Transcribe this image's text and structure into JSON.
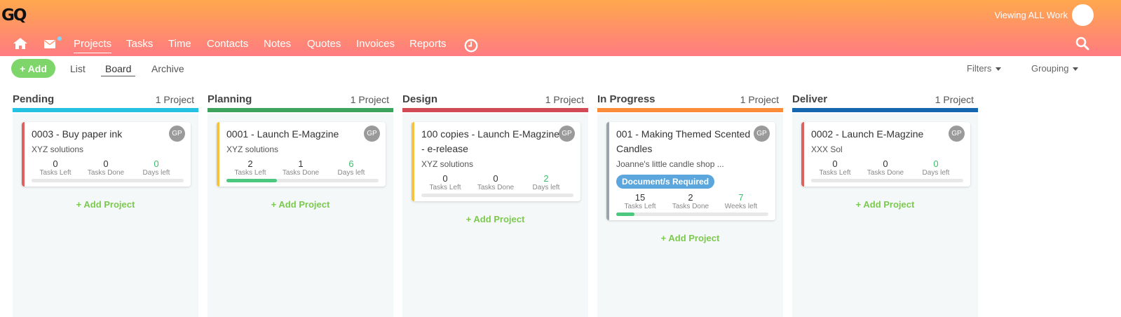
{
  "header": {
    "logo": "GQ",
    "viewing": "Viewing ALL Work",
    "nav": [
      "Projects",
      "Tasks",
      "Time",
      "Contacts",
      "Notes",
      "Quotes",
      "Invoices",
      "Reports"
    ],
    "icons": {
      "home": "home-icon",
      "mail": "mail-icon",
      "clock": "clock-icon",
      "search": "search-icon"
    }
  },
  "toolbar": {
    "add_label": "+ Add",
    "views": [
      "List",
      "Board",
      "Archive"
    ],
    "active_view": "Board",
    "filters": "Filters",
    "grouping": "Grouping"
  },
  "stat_labels": {
    "tasks_left": "Tasks Left",
    "tasks_done": "Tasks Done"
  },
  "add_project_label": "+ Add Project",
  "columns": [
    {
      "title": "Pending",
      "count": "1 Project",
      "color": "#24c1e0",
      "cards": [
        {
          "title": "0003 - Buy paper ink",
          "client": "XYZ solutions",
          "avatar": "GP",
          "accent": "#e06060",
          "tasks_left": "0",
          "tasks_done": "0",
          "remaining": "0",
          "remaining_label": "Days left",
          "progress": 0,
          "badge": ""
        }
      ]
    },
    {
      "title": "Planning",
      "count": "1 Project",
      "color": "#3da35d",
      "cards": [
        {
          "title": "0001 - Launch E-Magzine",
          "client": "XYZ solutions",
          "avatar": "GP",
          "accent": "#f5c242",
          "tasks_left": "2",
          "tasks_done": "1",
          "remaining": "6",
          "remaining_label": "Days left",
          "progress": 0.33,
          "badge": ""
        }
      ]
    },
    {
      "title": "Design",
      "count": "1 Project",
      "color": "#d14a55",
      "cards": [
        {
          "title": "100 copies - Launch E-Magzine - e-release",
          "client": "XYZ solutions",
          "avatar": "GP",
          "accent": "#f5c242",
          "tasks_left": "0",
          "tasks_done": "0",
          "remaining": "2",
          "remaining_label": "Days left",
          "progress": 0,
          "badge": ""
        }
      ]
    },
    {
      "title": "In Progress",
      "count": "1 Project",
      "color": "#fb8c3a",
      "cards": [
        {
          "title": "001 - Making Themed Scented Candles",
          "client": "Joanne's little candle shop ...",
          "avatar": "GP",
          "accent": "#9aa4b0",
          "tasks_left": "15",
          "tasks_done": "2",
          "remaining": "7",
          "remaining_label": "Weeks left",
          "progress": 0.12,
          "badge": "Document/s Required"
        }
      ]
    },
    {
      "title": "Deliver",
      "count": "1 Project",
      "color": "#1766b0",
      "cards": [
        {
          "title": "0002 - Launch E-Magzine",
          "client": "XXX Sol",
          "avatar": "GP",
          "accent": "#e06060",
          "tasks_left": "0",
          "tasks_done": "0",
          "remaining": "0",
          "remaining_label": "Days left",
          "progress": 0,
          "badge": ""
        }
      ]
    }
  ]
}
